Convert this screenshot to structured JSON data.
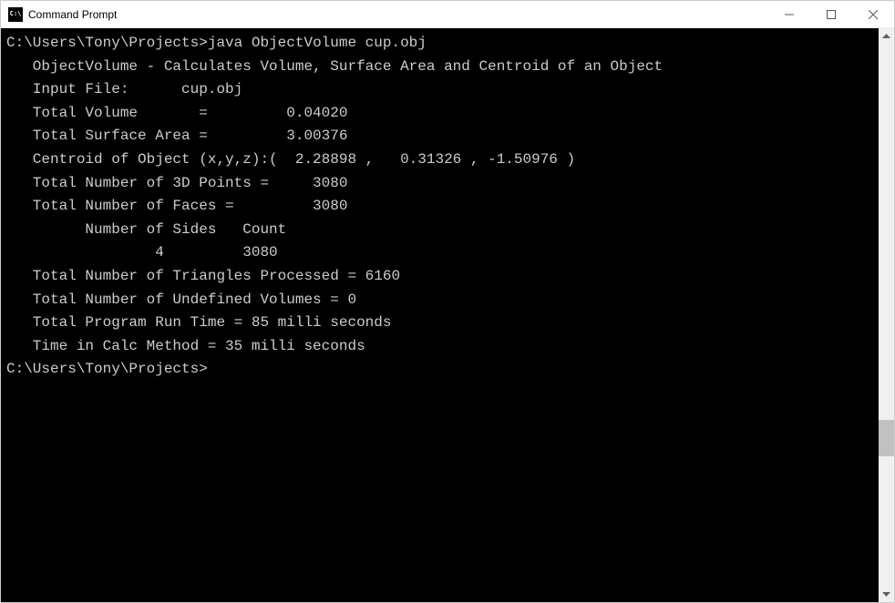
{
  "window": {
    "title": "Command Prompt"
  },
  "terminal": {
    "prompt1": "C:\\Users\\Tony\\Projects>",
    "command": "java ObjectVolume cup.obj",
    "line_blank": "",
    "line_appname": "   ObjectVolume - Calculates Volume, Surface Area and Centroid of an Object",
    "line_input": "   Input File:      cup.obj",
    "line_volume": "   Total Volume       =         0.04020",
    "line_surface": "   Total Surface Area =         3.00376",
    "line_centroid": "   Centroid of Object (x,y,z):(  2.28898 ,   0.31326 , -1.50976 )",
    "line_points": "   Total Number of 3D Points =     3080",
    "line_faces": "   Total Number of Faces =         3080",
    "line_sides_hdr": "         Number of Sides   Count",
    "line_sides_row": "                 4         3080",
    "line_tris": "   Total Number of Triangles Processed = 6160",
    "line_undef": "   Total Number of Undefined Volumes = 0",
    "line_runtime": "   Total Program Run Time = 85 milli seconds",
    "line_calctime": "   Time in Calc Method = 35 milli seconds",
    "prompt2": "C:\\Users\\Tony\\Projects>"
  }
}
